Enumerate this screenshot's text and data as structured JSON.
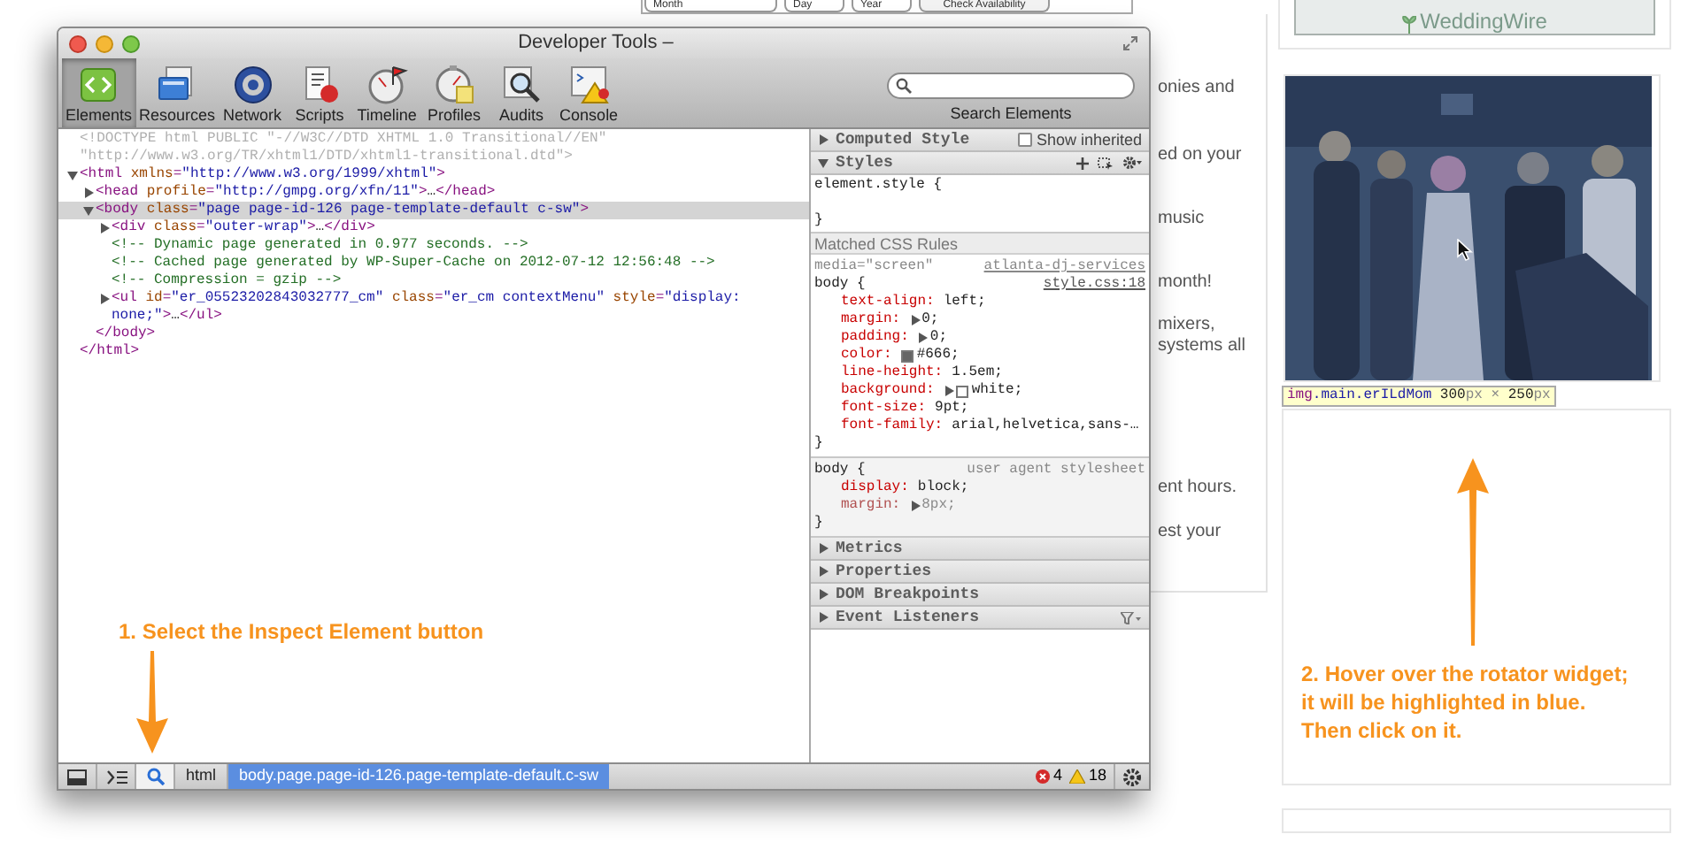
{
  "page": {
    "availability_form": {
      "fields": [
        "Month",
        "Day",
        "Year"
      ],
      "button": "Check Availability"
    },
    "text_fragments": [
      [
        "onies and"
      ],
      [
        "ed on your"
      ],
      [
        "music"
      ],
      [
        "month!"
      ],
      [
        "mixers,",
        "systems all"
      ],
      [
        "ent hours."
      ],
      [
        "est your"
      ]
    ],
    "logo": "WeddingWire",
    "tooltip": [
      {
        "kind": "tag",
        "text": "img"
      },
      {
        "kind": "class",
        "text": ".main.erILdMom"
      },
      {
        "kind": "num",
        "text": " 300"
      },
      {
        "kind": "unit",
        "text": "px"
      },
      {
        "kind": "unit",
        "text": " × "
      },
      {
        "kind": "num",
        "text": "250"
      },
      {
        "kind": "unit",
        "text": "px"
      }
    ]
  },
  "window": {
    "title": "Developer Tools –"
  },
  "toolbar": [
    {
      "kind": "elements",
      "label": "Elements",
      "selected": true
    },
    {
      "kind": "resources",
      "label": "Resources",
      "selected": false
    },
    {
      "kind": "network",
      "label": "Network",
      "selected": false
    },
    {
      "kind": "scripts",
      "label": "Scripts",
      "selected": false
    },
    {
      "kind": "timeline",
      "label": "Timeline",
      "selected": false
    },
    {
      "kind": "profiles",
      "label": "Profiles",
      "selected": false
    },
    {
      "kind": "audits",
      "label": "Audits",
      "selected": false
    },
    {
      "kind": "console",
      "label": "Console",
      "selected": false
    }
  ],
  "search": {
    "label": "Search Elements"
  },
  "dom_tree": [
    {
      "lines": [
        [
          {
            "kind": "doctype",
            "text": "<!DOCTYPE html PUBLIC \"-//W3C//DTD XHTML 1.0 Transitional//EN\""
          }
        ],
        [
          {
            "kind": "doctype",
            "text": "\"http://www.w3.org/TR/xhtml1/DTD/xhtml1-transitional.dtd\">"
          }
        ]
      ]
    },
    {
      "expanded": true,
      "selected": false,
      "lines": [
        [
          {
            "kind": "tag",
            "text": "<html"
          },
          {
            "kind": "attr",
            "text": " xmlns"
          },
          {
            "kind": "tag",
            "text": "="
          },
          {
            "kind": "value",
            "text": "\"http://www.w3.org/1999/xhtml\""
          },
          {
            "kind": "tag",
            "text": ">"
          }
        ]
      ],
      "children": [
        {
          "expanded": false,
          "selected": false,
          "lines": [
            [
              {
                "kind": "tag",
                "text": "<head"
              },
              {
                "kind": "attr",
                "text": " profile"
              },
              {
                "kind": "tag",
                "text": "="
              },
              {
                "kind": "value",
                "text": "\"http://gmpg.org/xfn/11\""
              },
              {
                "kind": "tag",
                "text": ">"
              },
              {
                "kind": "text",
                "text": "…"
              },
              {
                "kind": "tag",
                "text": "</head>"
              }
            ]
          ]
        },
        {
          "expanded": true,
          "selected": true,
          "lines": [
            [
              {
                "kind": "tag",
                "text": "<body"
              },
              {
                "kind": "attr",
                "text": " class"
              },
              {
                "kind": "tag",
                "text": "="
              },
              {
                "kind": "value",
                "text": "\"page page-id-126 page-template-default c-sw\""
              },
              {
                "kind": "tag",
                "text": ">"
              }
            ]
          ],
          "children": [
            {
              "expanded": false,
              "selected": false,
              "lines": [
                [
                  {
                    "kind": "tag",
                    "text": "<div"
                  },
                  {
                    "kind": "attr",
                    "text": " class"
                  },
                  {
                    "kind": "tag",
                    "text": "="
                  },
                  {
                    "kind": "value",
                    "text": "\"outer-wrap\""
                  },
                  {
                    "kind": "tag",
                    "text": ">"
                  },
                  {
                    "kind": "text",
                    "text": "…"
                  },
                  {
                    "kind": "tag",
                    "text": "</div>"
                  }
                ]
              ]
            },
            {
              "lines": [
                [
                  {
                    "kind": "comment",
                    "text": "<!-- Dynamic page generated in 0.977 seconds. -->"
                  }
                ]
              ]
            },
            {
              "lines": [
                [
                  {
                    "kind": "comment",
                    "text": "<!-- Cached page generated by WP-Super-Cache on 2012-07-12 12:56:48 -->"
                  }
                ]
              ]
            },
            {
              "lines": [
                [
                  {
                    "kind": "comment",
                    "text": "<!-- Compression = gzip -->"
                  }
                ]
              ]
            },
            {
              "expanded": false,
              "selected": false,
              "lines": [
                [
                  {
                    "kind": "tag",
                    "text": "<ul"
                  },
                  {
                    "kind": "attr",
                    "text": " id"
                  },
                  {
                    "kind": "tag",
                    "text": "="
                  },
                  {
                    "kind": "value",
                    "text": "\"er_05523202843032777_cm\""
                  },
                  {
                    "kind": "attr",
                    "text": " class"
                  },
                  {
                    "kind": "tag",
                    "text": "="
                  },
                  {
                    "kind": "value",
                    "text": "\"er_cm contextMenu\""
                  },
                  {
                    "kind": "attr",
                    "text": " style"
                  },
                  {
                    "kind": "tag",
                    "text": "="
                  },
                  {
                    "kind": "value",
                    "text": "\"display:"
                  }
                ],
                [
                  {
                    "kind": "value",
                    "text": "none;\""
                  },
                  {
                    "kind": "tag",
                    "text": ">"
                  },
                  {
                    "kind": "text",
                    "text": "…"
                  },
                  {
                    "kind": "tag",
                    "text": "</ul>"
                  }
                ]
              ]
            }
          ],
          "closing": [
            {
              "kind": "tag",
              "text": "</body>"
            }
          ]
        }
      ],
      "closing": [
        {
          "kind": "tag",
          "text": "</html>"
        }
      ]
    }
  ],
  "styles_panel": {
    "computed_style": {
      "label": "Computed Style",
      "expanded": false
    },
    "show_inherited": {
      "label": "Show inherited",
      "checked": false
    },
    "styles": {
      "label": "Styles",
      "expanded": true
    },
    "element_style": {
      "open": "element.style {",
      "close": "}"
    },
    "matched_header": "Matched CSS Rules",
    "rules": [
      {
        "kind": "author",
        "media": "media=\"screen\"",
        "source": [
          "atlanta-dj-services",
          "style.css:18"
        ],
        "selector": "body {",
        "close": "}",
        "props": [
          {
            "name": "text-align:",
            "value": "left;",
            "expandable": false,
            "overridden": false
          },
          {
            "name": "margin:",
            "value": "0;",
            "expandable": true,
            "overridden": false
          },
          {
            "name": "padding:",
            "value": "0;",
            "expandable": true,
            "overridden": false
          },
          {
            "name": "color:",
            "value": "#666;",
            "expandable": false,
            "overridden": false,
            "color": "#666666"
          },
          {
            "name": "line-height:",
            "value": "1.5em;",
            "expandable": false,
            "overridden": false
          },
          {
            "name": "background:",
            "value": "white;",
            "expandable": true,
            "overridden": false,
            "color": "#ffffff"
          },
          {
            "name": "font-size:",
            "value": "9pt;",
            "expandable": false,
            "overridden": false
          },
          {
            "name": "font-family:",
            "value": "arial,helvetica,sans-…",
            "expandable": false,
            "overridden": false
          }
        ]
      },
      {
        "kind": "user_agent",
        "origin": "user agent stylesheet",
        "selector": "body {",
        "close": "}",
        "props": [
          {
            "name": "display:",
            "value": "block;",
            "expandable": false,
            "overridden": false
          },
          {
            "name": "margin:",
            "value": "8px;",
            "expandable": true,
            "overridden": true
          }
        ]
      }
    ],
    "sections": [
      {
        "label": "Metrics",
        "expanded": false,
        "filter": false
      },
      {
        "label": "Properties",
        "expanded": false,
        "filter": false
      },
      {
        "label": "DOM Breakpoints",
        "expanded": false,
        "filter": false
      },
      {
        "label": "Event Listeners",
        "expanded": false,
        "filter": true
      }
    ]
  },
  "bottom_bar": {
    "buttons": [
      {
        "kind": "dock",
        "selected": false
      },
      {
        "kind": "console",
        "selected": false
      },
      {
        "kind": "inspect",
        "selected": true
      }
    ],
    "breadcrumbs": [
      {
        "label": "html",
        "selected": false
      },
      {
        "label": "body.page.page-id-126.page-template-default.c-sw",
        "selected": true
      }
    ],
    "errors": "4",
    "warnings": "18"
  },
  "annotations": [
    {
      "lines": [
        "1. Select the Inspect Element button"
      ]
    },
    {
      "lines": [
        "2. Hover over the rotator widget;",
        "it will be highlighted in blue.",
        "Then click on it."
      ]
    }
  ]
}
